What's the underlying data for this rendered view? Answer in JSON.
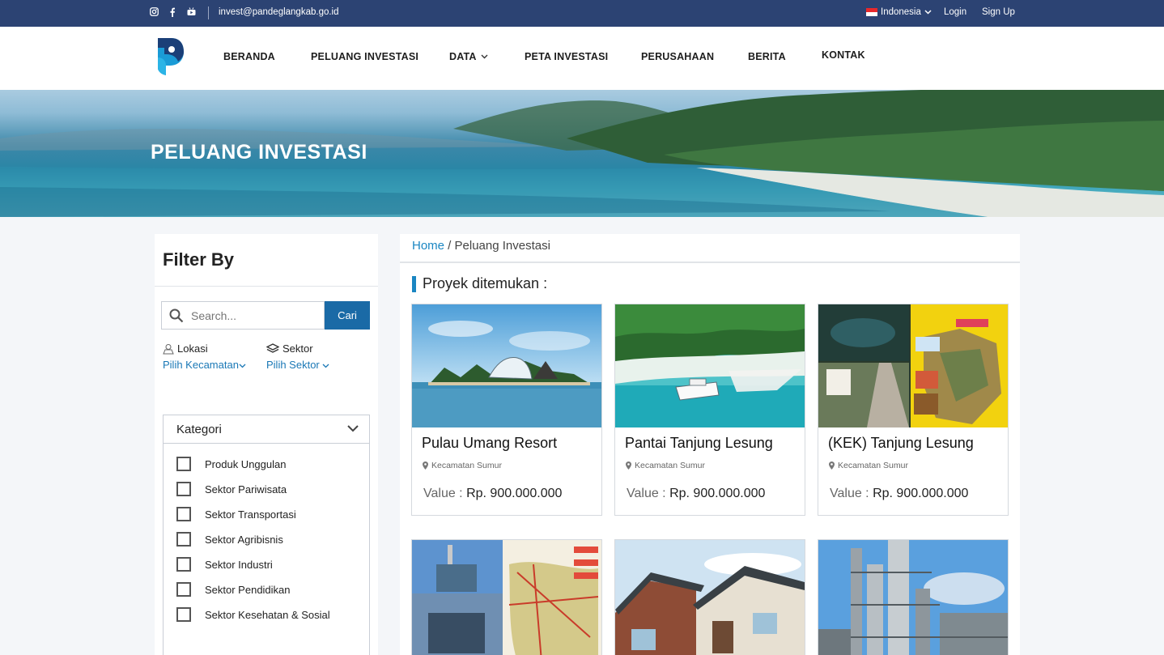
{
  "topbar": {
    "email": "invest@pandeglangkab.go.id",
    "language": "Indonesia",
    "login": "Login",
    "signup": "Sign Up"
  },
  "nav": {
    "items": [
      "BERANDA",
      "PELUANG INVESTASI",
      "DATA",
      "PETA INVESTASI",
      "PERUSAHAAN",
      "BERITA",
      "KONTAK"
    ]
  },
  "hero": {
    "title": "PELUANG INVESTASI"
  },
  "sidebar": {
    "title": "Filter By",
    "search_placeholder": "Search...",
    "search_button": "Cari",
    "lokasi_label": "Lokasi",
    "lokasi_pick": "Pilih Kecamatan",
    "sektor_label": "Sektor",
    "sektor_pick": "Pilih Sektor",
    "kategori_title": "Kategori",
    "kategori_items": [
      "Produk Unggulan",
      "Sektor Pariwisata",
      "Sektor Transportasi",
      "Sektor Agribisnis",
      "Sektor Industri",
      "Sektor Pendidikan",
      "Sektor Kesehatan & Sosial"
    ]
  },
  "main": {
    "breadcrumb_home": "Home",
    "breadcrumb_current": " / Peluang Investasi",
    "found_label": "Proyek ditemukan :",
    "value_label": "Value : ",
    "cards": [
      {
        "name": "Pulau Umang Resort",
        "location": "Kecamatan Sumur",
        "value": "Rp. 900.000.000"
      },
      {
        "name": "Pantai Tanjung Lesung",
        "location": "Kecamatan Sumur",
        "value": "Rp. 900.000.000"
      },
      {
        "name": "(KEK) Tanjung Lesung",
        "location": "Kecamatan Sumur",
        "value": "Rp. 900.000.000"
      }
    ]
  },
  "colors": {
    "topbar": "#2c4373",
    "accent": "#1a86c2",
    "button": "#1a6aa6"
  },
  "icons": [
    "instagram-icon",
    "facebook-icon",
    "youtube-icon",
    "flag-id-icon",
    "chevron-down-icon",
    "search-icon",
    "location-pin-icon",
    "layers-icon"
  ]
}
